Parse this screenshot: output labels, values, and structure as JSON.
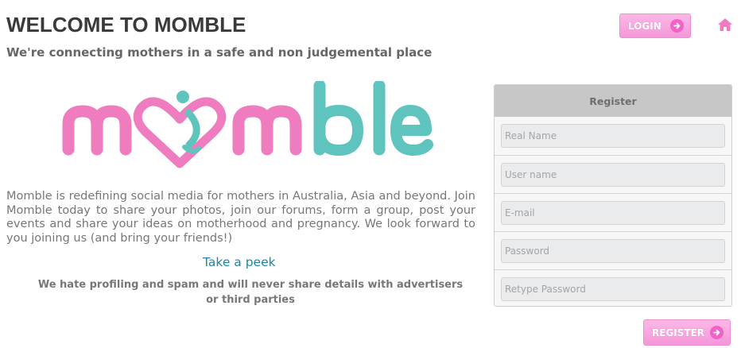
{
  "header": {
    "title": "WELCOME TO MOMBLE",
    "subtitle": "We're connecting mothers in a safe and non judgemental place",
    "login_label": "LOGIN"
  },
  "logo": {
    "text": "momble",
    "pink_color": "#f07cc0",
    "teal_color": "#5ec4bd"
  },
  "intro": {
    "paragraph": "Momble is redefining social media for mothers in Australia, Asia and beyond. Join Momble today to share your photos, join our forums, form a group, post your events and share your ideas on motherhood and pregnancy. We look forward to you joining us (and bring your friends!)",
    "peek_link": "Take a peek",
    "privacy_line1": "We hate profiling and spam and will never share details with advertisers",
    "privacy_line2": "or third parties"
  },
  "register": {
    "title": "Register",
    "fields": [
      {
        "placeholder": "Real Name"
      },
      {
        "placeholder": "User name"
      },
      {
        "placeholder": "E-mail"
      },
      {
        "placeholder": "Password"
      },
      {
        "placeholder": "Retype Password"
      }
    ],
    "button_label": "REGISTER"
  },
  "icons": {
    "home": "home-icon",
    "arrow": "arrow-right-circle-icon"
  },
  "colors": {
    "accent_pink": "#f596d9",
    "link_blue": "#1f86a6"
  }
}
